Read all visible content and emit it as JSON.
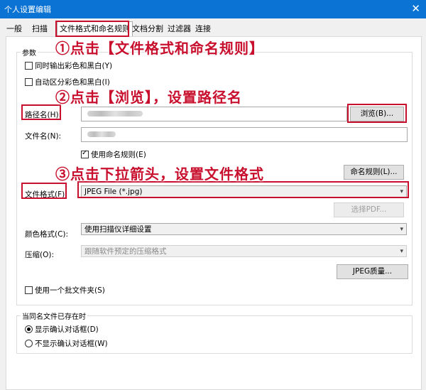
{
  "window": {
    "title": "个人设置编辑",
    "close_glyph": "✕"
  },
  "tabs": [
    {
      "label": "一般"
    },
    {
      "label": "扫描"
    },
    {
      "label": "文件格式和命名规则"
    },
    {
      "label": "文档分割"
    },
    {
      "label": "过滤器"
    },
    {
      "label": "连接"
    }
  ],
  "params": {
    "group_title": "参数",
    "output_color_bw": {
      "label": "同时输出彩色和黑白(Y)",
      "checked": false
    },
    "auto_color_bw": {
      "label": "自动区分彩色和黑白(I)",
      "checked": false
    },
    "path": {
      "label": "路径名(H):",
      "browse_label": "浏览(B)..."
    },
    "filename": {
      "label": "文件名(N):"
    },
    "use_naming_rule": {
      "label": "使用命名规则(E)",
      "checked": true
    },
    "naming_rule_button": "命名规则(L)...",
    "file_format": {
      "label": "文件格式(F):",
      "value": "JPEG File (*.jpg)"
    },
    "select_pdf_button": "选择PDF...",
    "color_format": {
      "label": "颜色格式(C):",
      "value": "使用扫描仪详细设置"
    },
    "compression": {
      "label": "压缩(O):",
      "value": "跟随软件预定的压缩格式"
    },
    "jpeg_quality_button": "JPEG质量...",
    "use_batch_folder": {
      "label": "使用一个批文件夹(S)",
      "checked": false
    }
  },
  "same_name": {
    "group_title": "当同名文件已存在时",
    "options": [
      {
        "label": "显示确认对话框(D)",
        "selected": true
      },
      {
        "label": "不显示确认对话框(W)",
        "selected": false
      }
    ]
  },
  "annotations": [
    {
      "text": "①点击【文件格式和命名规则】"
    },
    {
      "text": "②点击【浏览】，设置路径名"
    },
    {
      "text": "③点击下拉箭头，设置文件格式"
    }
  ],
  "colors": {
    "titlebar": "#0a73d4",
    "highlight": "#c8102e",
    "panel": "#ffffff",
    "client": "#f0f0f0"
  }
}
